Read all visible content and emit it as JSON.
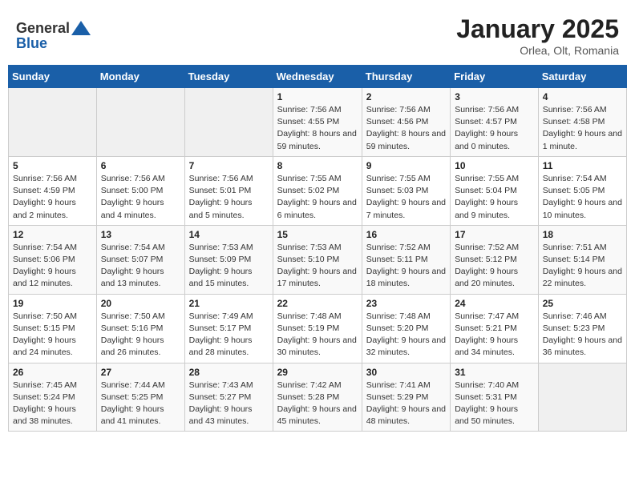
{
  "header": {
    "logo_general": "General",
    "logo_blue": "Blue",
    "month": "January 2025",
    "location": "Orlea, Olt, Romania"
  },
  "weekdays": [
    "Sunday",
    "Monday",
    "Tuesday",
    "Wednesday",
    "Thursday",
    "Friday",
    "Saturday"
  ],
  "weeks": [
    [
      {
        "day": "",
        "sunrise": "",
        "sunset": "",
        "daylight": ""
      },
      {
        "day": "",
        "sunrise": "",
        "sunset": "",
        "daylight": ""
      },
      {
        "day": "",
        "sunrise": "",
        "sunset": "",
        "daylight": ""
      },
      {
        "day": "1",
        "sunrise": "Sunrise: 7:56 AM",
        "sunset": "Sunset: 4:55 PM",
        "daylight": "Daylight: 8 hours and 59 minutes."
      },
      {
        "day": "2",
        "sunrise": "Sunrise: 7:56 AM",
        "sunset": "Sunset: 4:56 PM",
        "daylight": "Daylight: 8 hours and 59 minutes."
      },
      {
        "day": "3",
        "sunrise": "Sunrise: 7:56 AM",
        "sunset": "Sunset: 4:57 PM",
        "daylight": "Daylight: 9 hours and 0 minutes."
      },
      {
        "day": "4",
        "sunrise": "Sunrise: 7:56 AM",
        "sunset": "Sunset: 4:58 PM",
        "daylight": "Daylight: 9 hours and 1 minute."
      }
    ],
    [
      {
        "day": "5",
        "sunrise": "Sunrise: 7:56 AM",
        "sunset": "Sunset: 4:59 PM",
        "daylight": "Daylight: 9 hours and 2 minutes."
      },
      {
        "day": "6",
        "sunrise": "Sunrise: 7:56 AM",
        "sunset": "Sunset: 5:00 PM",
        "daylight": "Daylight: 9 hours and 4 minutes."
      },
      {
        "day": "7",
        "sunrise": "Sunrise: 7:56 AM",
        "sunset": "Sunset: 5:01 PM",
        "daylight": "Daylight: 9 hours and 5 minutes."
      },
      {
        "day": "8",
        "sunrise": "Sunrise: 7:55 AM",
        "sunset": "Sunset: 5:02 PM",
        "daylight": "Daylight: 9 hours and 6 minutes."
      },
      {
        "day": "9",
        "sunrise": "Sunrise: 7:55 AM",
        "sunset": "Sunset: 5:03 PM",
        "daylight": "Daylight: 9 hours and 7 minutes."
      },
      {
        "day": "10",
        "sunrise": "Sunrise: 7:55 AM",
        "sunset": "Sunset: 5:04 PM",
        "daylight": "Daylight: 9 hours and 9 minutes."
      },
      {
        "day": "11",
        "sunrise": "Sunrise: 7:54 AM",
        "sunset": "Sunset: 5:05 PM",
        "daylight": "Daylight: 9 hours and 10 minutes."
      }
    ],
    [
      {
        "day": "12",
        "sunrise": "Sunrise: 7:54 AM",
        "sunset": "Sunset: 5:06 PM",
        "daylight": "Daylight: 9 hours and 12 minutes."
      },
      {
        "day": "13",
        "sunrise": "Sunrise: 7:54 AM",
        "sunset": "Sunset: 5:07 PM",
        "daylight": "Daylight: 9 hours and 13 minutes."
      },
      {
        "day": "14",
        "sunrise": "Sunrise: 7:53 AM",
        "sunset": "Sunset: 5:09 PM",
        "daylight": "Daylight: 9 hours and 15 minutes."
      },
      {
        "day": "15",
        "sunrise": "Sunrise: 7:53 AM",
        "sunset": "Sunset: 5:10 PM",
        "daylight": "Daylight: 9 hours and 17 minutes."
      },
      {
        "day": "16",
        "sunrise": "Sunrise: 7:52 AM",
        "sunset": "Sunset: 5:11 PM",
        "daylight": "Daylight: 9 hours and 18 minutes."
      },
      {
        "day": "17",
        "sunrise": "Sunrise: 7:52 AM",
        "sunset": "Sunset: 5:12 PM",
        "daylight": "Daylight: 9 hours and 20 minutes."
      },
      {
        "day": "18",
        "sunrise": "Sunrise: 7:51 AM",
        "sunset": "Sunset: 5:14 PM",
        "daylight": "Daylight: 9 hours and 22 minutes."
      }
    ],
    [
      {
        "day": "19",
        "sunrise": "Sunrise: 7:50 AM",
        "sunset": "Sunset: 5:15 PM",
        "daylight": "Daylight: 9 hours and 24 minutes."
      },
      {
        "day": "20",
        "sunrise": "Sunrise: 7:50 AM",
        "sunset": "Sunset: 5:16 PM",
        "daylight": "Daylight: 9 hours and 26 minutes."
      },
      {
        "day": "21",
        "sunrise": "Sunrise: 7:49 AM",
        "sunset": "Sunset: 5:17 PM",
        "daylight": "Daylight: 9 hours and 28 minutes."
      },
      {
        "day": "22",
        "sunrise": "Sunrise: 7:48 AM",
        "sunset": "Sunset: 5:19 PM",
        "daylight": "Daylight: 9 hours and 30 minutes."
      },
      {
        "day": "23",
        "sunrise": "Sunrise: 7:48 AM",
        "sunset": "Sunset: 5:20 PM",
        "daylight": "Daylight: 9 hours and 32 minutes."
      },
      {
        "day": "24",
        "sunrise": "Sunrise: 7:47 AM",
        "sunset": "Sunset: 5:21 PM",
        "daylight": "Daylight: 9 hours and 34 minutes."
      },
      {
        "day": "25",
        "sunrise": "Sunrise: 7:46 AM",
        "sunset": "Sunset: 5:23 PM",
        "daylight": "Daylight: 9 hours and 36 minutes."
      }
    ],
    [
      {
        "day": "26",
        "sunrise": "Sunrise: 7:45 AM",
        "sunset": "Sunset: 5:24 PM",
        "daylight": "Daylight: 9 hours and 38 minutes."
      },
      {
        "day": "27",
        "sunrise": "Sunrise: 7:44 AM",
        "sunset": "Sunset: 5:25 PM",
        "daylight": "Daylight: 9 hours and 41 minutes."
      },
      {
        "day": "28",
        "sunrise": "Sunrise: 7:43 AM",
        "sunset": "Sunset: 5:27 PM",
        "daylight": "Daylight: 9 hours and 43 minutes."
      },
      {
        "day": "29",
        "sunrise": "Sunrise: 7:42 AM",
        "sunset": "Sunset: 5:28 PM",
        "daylight": "Daylight: 9 hours and 45 minutes."
      },
      {
        "day": "30",
        "sunrise": "Sunrise: 7:41 AM",
        "sunset": "Sunset: 5:29 PM",
        "daylight": "Daylight: 9 hours and 48 minutes."
      },
      {
        "day": "31",
        "sunrise": "Sunrise: 7:40 AM",
        "sunset": "Sunset: 5:31 PM",
        "daylight": "Daylight: 9 hours and 50 minutes."
      },
      {
        "day": "",
        "sunrise": "",
        "sunset": "",
        "daylight": ""
      }
    ]
  ]
}
